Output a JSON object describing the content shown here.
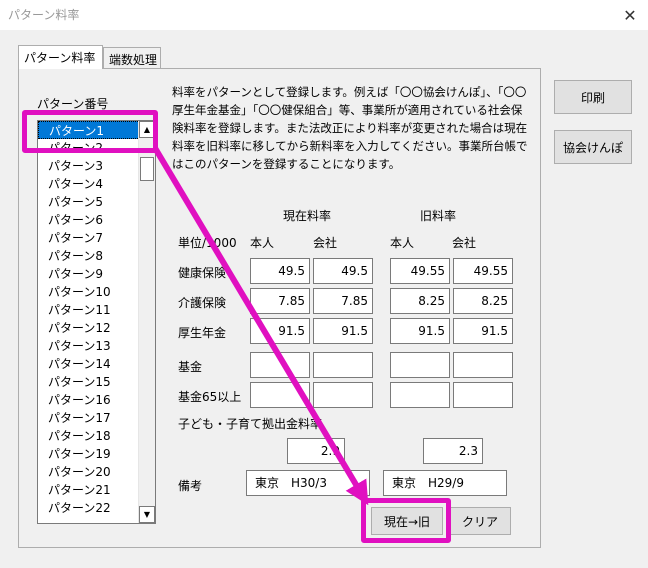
{
  "window": {
    "title": "パターン料率",
    "close": "✕"
  },
  "tabs": [
    {
      "label": "パターン料率"
    },
    {
      "label": "端数処理"
    }
  ],
  "description": "料率をパターンとして登録します。例えば「〇〇協会けんぽ」、「〇〇厚生年金基金」「〇〇健保組合」等、事業所が適用されている社会保険料率を登録します。また法改正により料率が変更された場合は現在料率を旧料率に移してから新料率を入力してください。事業所台帳ではこのパターンを登録することになります。",
  "pattern_list": {
    "label": "パターン番号",
    "items": [
      "パターン1",
      "パターン2",
      "パターン3",
      "パターン4",
      "パターン5",
      "パターン6",
      "パターン7",
      "パターン8",
      "パターン9",
      "パターン10",
      "パターン11",
      "パターン12",
      "パターン13",
      "パターン14",
      "パターン15",
      "パターン16",
      "パターン17",
      "パターン18",
      "パターン19",
      "パターン20",
      "パターン21",
      "パターン22"
    ],
    "selected_index": 0
  },
  "rates": {
    "current_header": "現在料率",
    "old_header": "旧料率",
    "unit": "単位/1000",
    "col_person": "本人",
    "col_company": "会社",
    "rows": [
      {
        "label": "健康保険",
        "cur_person": "49.5",
        "cur_company": "49.5",
        "old_person": "49.55",
        "old_company": "49.55"
      },
      {
        "label": "介護保険",
        "cur_person": "7.85",
        "cur_company": "7.85",
        "old_person": "8.25",
        "old_company": "8.25"
      },
      {
        "label": "厚生年金",
        "cur_person": "91.5",
        "cur_company": "91.5",
        "old_person": "91.5",
        "old_company": "91.5"
      },
      {
        "label": "基金",
        "cur_person": "",
        "cur_company": "",
        "old_person": "",
        "old_company": ""
      },
      {
        "label": "基金65以上",
        "cur_person": "",
        "cur_company": "",
        "old_person": "",
        "old_company": ""
      }
    ],
    "child_label": "子ども・子育て拠出金料率",
    "child_current": "2.9",
    "child_old": "2.3",
    "remarks_label": "備考",
    "remarks_current": "東京　H30/3",
    "remarks_old": "東京　H29/9"
  },
  "buttons": {
    "print": "印刷",
    "kyokai": "協会けんぽ",
    "move": "現在→旧",
    "clear": "クリア"
  },
  "annotation_color": "#e010c0"
}
